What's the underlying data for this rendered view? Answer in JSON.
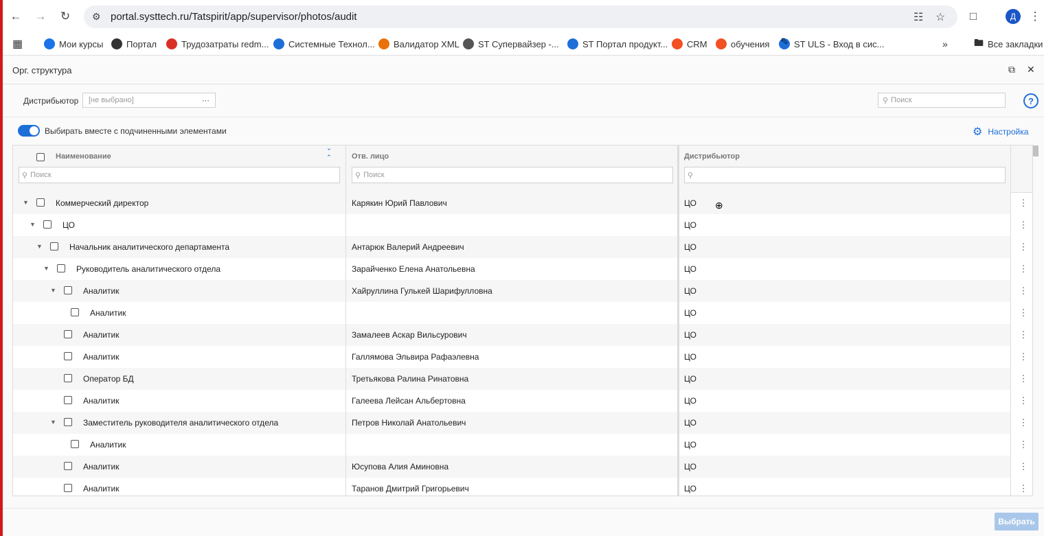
{
  "browser": {
    "url": "portal.systtech.ru/Tatspirit/app/supervisor/photos/audit",
    "avatar_letter": "Д",
    "bookmarks": [
      {
        "label": "Мои курсы",
        "color": "#1a73e8"
      },
      {
        "label": "Портал",
        "color": "#333333"
      },
      {
        "label": "Трудозатраты redm...",
        "color": "#d93025"
      },
      {
        "label": "Системные Технол...",
        "color": "#1d6fd8"
      },
      {
        "label": "Валидатор XML",
        "color": "#e8710a"
      },
      {
        "label": "ST Супервайзер -...",
        "color": "#555555"
      },
      {
        "label": "ST Портал продукт...",
        "color": "#1d6fd8"
      },
      {
        "label": "CRM",
        "color": "#f25022"
      },
      {
        "label": "обучения",
        "color": "#f25022"
      },
      {
        "label": "ST ULS - Вход в сис...",
        "color": "#1d6fd8"
      }
    ],
    "all_bookmarks": "Все закладки"
  },
  "app": {
    "title": "Орг. структура",
    "distributor_label": "Дистрибьютор",
    "distributor_placeholder": "[не выбрано]",
    "search_placeholder": "Поиск",
    "toggle_label": "Выбирать вместе с подчиненными элементами",
    "settings_label": "Настройка",
    "select_button": "Выбрать",
    "accent_color": "#1d6fd8"
  },
  "grid": {
    "columns": [
      "Наименование",
      "Отв. лицо",
      "Дистрибьютор"
    ],
    "search_placeholder": "Поиск",
    "rows": [
      {
        "level": 0,
        "expanded": true,
        "name": "Коммерческий директор",
        "person": "Карякин Юрий Павлович",
        "dist": "ЦО"
      },
      {
        "level": 1,
        "expanded": true,
        "name": "ЦО",
        "person": "",
        "dist": "ЦО"
      },
      {
        "level": 2,
        "expanded": true,
        "name": "Начальник аналитического департамента",
        "person": "Антарюк Валерий Андреевич",
        "dist": "ЦО"
      },
      {
        "level": 3,
        "expanded": true,
        "name": "Руководитель аналитического отдела",
        "person": "Зарайченко Елена Анатольевна",
        "dist": "ЦО"
      },
      {
        "level": 4,
        "expanded": true,
        "name": "Аналитик",
        "person": "Хайруллина Гулькей Шарифулловна",
        "dist": "ЦО"
      },
      {
        "level": 5,
        "expanded": false,
        "name": "Аналитик",
        "person": "",
        "dist": "ЦО"
      },
      {
        "level": 4,
        "expanded": false,
        "name": "Аналитик",
        "person": "Замалеев Аскар Вильсурович",
        "dist": "ЦО"
      },
      {
        "level": 4,
        "expanded": false,
        "name": "Аналитик",
        "person": "Галлямова Эльвира Рафаэлевна",
        "dist": "ЦО"
      },
      {
        "level": 4,
        "expanded": false,
        "name": "Оператор БД",
        "person": "Третьякова Ралина Ринатовна",
        "dist": "ЦО"
      },
      {
        "level": 4,
        "expanded": false,
        "name": "Аналитик",
        "person": "Галеева Лейсан Альбертовна",
        "dist": "ЦО"
      },
      {
        "level": 4,
        "expanded": true,
        "name": "Заместитель руководителя аналитического отдела",
        "person": "Петров Николай Анатольевич",
        "dist": "ЦО"
      },
      {
        "level": 5,
        "expanded": false,
        "name": "Аналитик",
        "person": "",
        "dist": "ЦО"
      },
      {
        "level": 4,
        "expanded": false,
        "name": "Аналитик",
        "person": "Юсупова Алия Аминовна",
        "dist": "ЦО"
      },
      {
        "level": 4,
        "expanded": false,
        "name": "Аналитик",
        "person": "Таранов Дмитрий Григорьевич",
        "dist": "ЦО"
      }
    ]
  }
}
